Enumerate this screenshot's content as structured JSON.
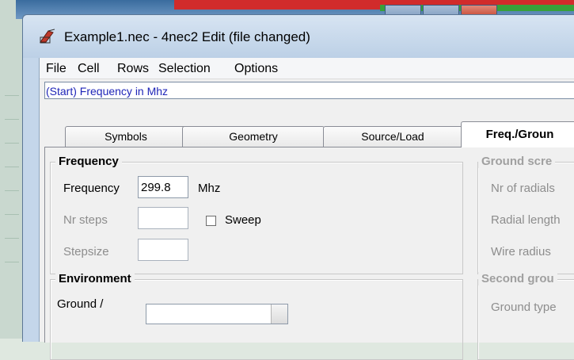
{
  "window": {
    "title": "Example1.nec - 4nec2 Edit (file changed)"
  },
  "menu": {
    "items": [
      "File",
      "Cell",
      "Rows",
      "Selection",
      "Options"
    ]
  },
  "command_line": {
    "text": "(Start) Frequency in Mhz"
  },
  "tabs": [
    {
      "label": "Symbols"
    },
    {
      "label": "Geometry"
    },
    {
      "label": "Source/Load"
    },
    {
      "label": "Freq./Groun",
      "active": true
    }
  ],
  "frequency_group": {
    "title": "Frequency",
    "frequency_label": "Frequency",
    "frequency_value": "299.8",
    "frequency_unit": "Mhz",
    "nr_steps_label": "Nr steps",
    "nr_steps_value": "",
    "sweep_label": "Sweep",
    "stepsize_label": "Stepsize",
    "stepsize_value": ""
  },
  "ground_screen_group": {
    "title": "Ground scre",
    "nr_radials_label": "Nr of radials",
    "radial_length_label": "Radial length",
    "wire_radius_label": "Wire radius"
  },
  "environment_group": {
    "title": "Environment",
    "ground_label": "Ground  /"
  },
  "second_ground_group": {
    "title": "Second grou",
    "ground_type_label": "Ground type"
  },
  "colors": {
    "command_text": "#1f26b8",
    "disabled_text": "#8d8d8d",
    "title_gradient_top": "#d7e4f2"
  }
}
